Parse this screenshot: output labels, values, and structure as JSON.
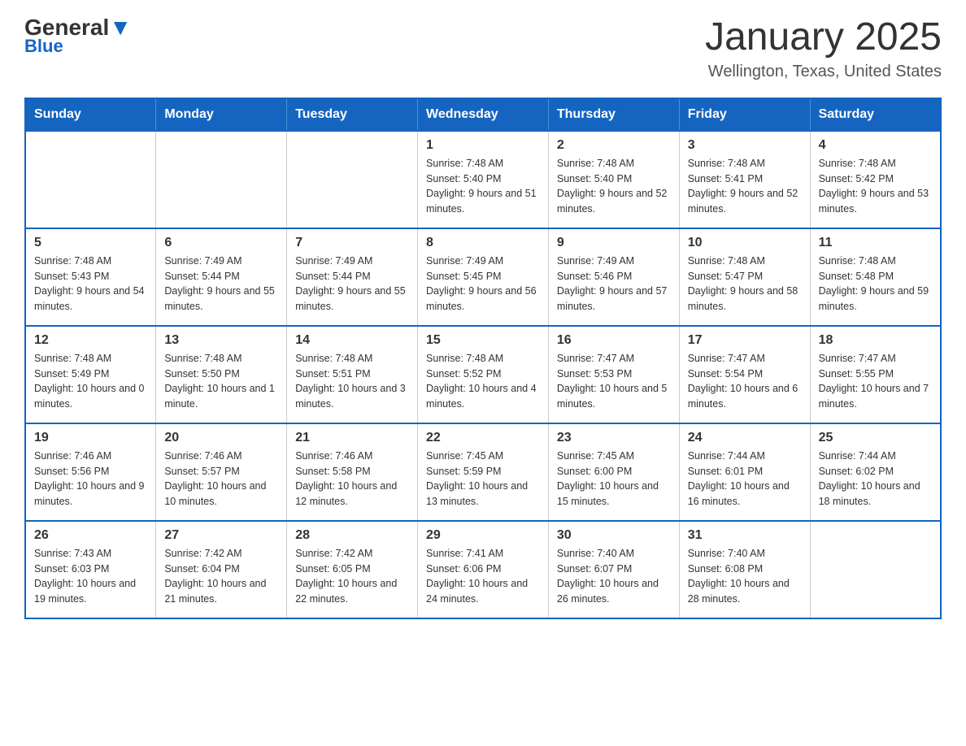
{
  "logo": {
    "general": "General",
    "blue": "Blue"
  },
  "title": {
    "month": "January 2025",
    "location": "Wellington, Texas, United States"
  },
  "calendar": {
    "headers": [
      "Sunday",
      "Monday",
      "Tuesday",
      "Wednesday",
      "Thursday",
      "Friday",
      "Saturday"
    ],
    "weeks": [
      [
        {
          "day": "",
          "info": ""
        },
        {
          "day": "",
          "info": ""
        },
        {
          "day": "",
          "info": ""
        },
        {
          "day": "1",
          "info": "Sunrise: 7:48 AM\nSunset: 5:40 PM\nDaylight: 9 hours and 51 minutes."
        },
        {
          "day": "2",
          "info": "Sunrise: 7:48 AM\nSunset: 5:40 PM\nDaylight: 9 hours and 52 minutes."
        },
        {
          "day": "3",
          "info": "Sunrise: 7:48 AM\nSunset: 5:41 PM\nDaylight: 9 hours and 52 minutes."
        },
        {
          "day": "4",
          "info": "Sunrise: 7:48 AM\nSunset: 5:42 PM\nDaylight: 9 hours and 53 minutes."
        }
      ],
      [
        {
          "day": "5",
          "info": "Sunrise: 7:48 AM\nSunset: 5:43 PM\nDaylight: 9 hours and 54 minutes."
        },
        {
          "day": "6",
          "info": "Sunrise: 7:49 AM\nSunset: 5:44 PM\nDaylight: 9 hours and 55 minutes."
        },
        {
          "day": "7",
          "info": "Sunrise: 7:49 AM\nSunset: 5:44 PM\nDaylight: 9 hours and 55 minutes."
        },
        {
          "day": "8",
          "info": "Sunrise: 7:49 AM\nSunset: 5:45 PM\nDaylight: 9 hours and 56 minutes."
        },
        {
          "day": "9",
          "info": "Sunrise: 7:49 AM\nSunset: 5:46 PM\nDaylight: 9 hours and 57 minutes."
        },
        {
          "day": "10",
          "info": "Sunrise: 7:48 AM\nSunset: 5:47 PM\nDaylight: 9 hours and 58 minutes."
        },
        {
          "day": "11",
          "info": "Sunrise: 7:48 AM\nSunset: 5:48 PM\nDaylight: 9 hours and 59 minutes."
        }
      ],
      [
        {
          "day": "12",
          "info": "Sunrise: 7:48 AM\nSunset: 5:49 PM\nDaylight: 10 hours and 0 minutes."
        },
        {
          "day": "13",
          "info": "Sunrise: 7:48 AM\nSunset: 5:50 PM\nDaylight: 10 hours and 1 minute."
        },
        {
          "day": "14",
          "info": "Sunrise: 7:48 AM\nSunset: 5:51 PM\nDaylight: 10 hours and 3 minutes."
        },
        {
          "day": "15",
          "info": "Sunrise: 7:48 AM\nSunset: 5:52 PM\nDaylight: 10 hours and 4 minutes."
        },
        {
          "day": "16",
          "info": "Sunrise: 7:47 AM\nSunset: 5:53 PM\nDaylight: 10 hours and 5 minutes."
        },
        {
          "day": "17",
          "info": "Sunrise: 7:47 AM\nSunset: 5:54 PM\nDaylight: 10 hours and 6 minutes."
        },
        {
          "day": "18",
          "info": "Sunrise: 7:47 AM\nSunset: 5:55 PM\nDaylight: 10 hours and 7 minutes."
        }
      ],
      [
        {
          "day": "19",
          "info": "Sunrise: 7:46 AM\nSunset: 5:56 PM\nDaylight: 10 hours and 9 minutes."
        },
        {
          "day": "20",
          "info": "Sunrise: 7:46 AM\nSunset: 5:57 PM\nDaylight: 10 hours and 10 minutes."
        },
        {
          "day": "21",
          "info": "Sunrise: 7:46 AM\nSunset: 5:58 PM\nDaylight: 10 hours and 12 minutes."
        },
        {
          "day": "22",
          "info": "Sunrise: 7:45 AM\nSunset: 5:59 PM\nDaylight: 10 hours and 13 minutes."
        },
        {
          "day": "23",
          "info": "Sunrise: 7:45 AM\nSunset: 6:00 PM\nDaylight: 10 hours and 15 minutes."
        },
        {
          "day": "24",
          "info": "Sunrise: 7:44 AM\nSunset: 6:01 PM\nDaylight: 10 hours and 16 minutes."
        },
        {
          "day": "25",
          "info": "Sunrise: 7:44 AM\nSunset: 6:02 PM\nDaylight: 10 hours and 18 minutes."
        }
      ],
      [
        {
          "day": "26",
          "info": "Sunrise: 7:43 AM\nSunset: 6:03 PM\nDaylight: 10 hours and 19 minutes."
        },
        {
          "day": "27",
          "info": "Sunrise: 7:42 AM\nSunset: 6:04 PM\nDaylight: 10 hours and 21 minutes."
        },
        {
          "day": "28",
          "info": "Sunrise: 7:42 AM\nSunset: 6:05 PM\nDaylight: 10 hours and 22 minutes."
        },
        {
          "day": "29",
          "info": "Sunrise: 7:41 AM\nSunset: 6:06 PM\nDaylight: 10 hours and 24 minutes."
        },
        {
          "day": "30",
          "info": "Sunrise: 7:40 AM\nSunset: 6:07 PM\nDaylight: 10 hours and 26 minutes."
        },
        {
          "day": "31",
          "info": "Sunrise: 7:40 AM\nSunset: 6:08 PM\nDaylight: 10 hours and 28 minutes."
        },
        {
          "day": "",
          "info": ""
        }
      ]
    ]
  }
}
